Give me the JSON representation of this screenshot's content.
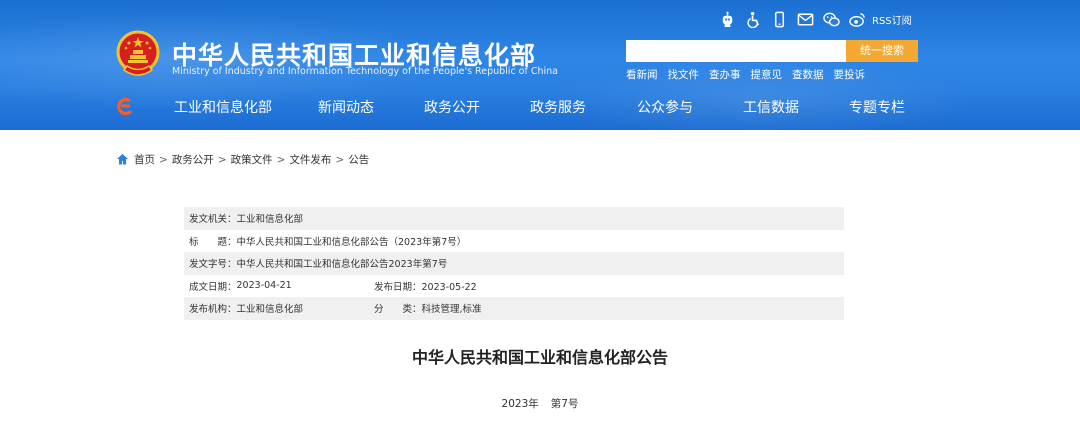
{
  "header": {
    "site_title": "中华人民共和国工业和信息化部",
    "site_subtitle": "Ministry of Industry and Information Technology of the People's Republic of China",
    "top_icons": [
      "robot-icon",
      "accessibility-icon",
      "mobile-icon",
      "mail-icon",
      "wechat-icon",
      "weibo-icon"
    ],
    "rss_label": "RSS订阅",
    "search_placeholder": "",
    "search_button": "统一搜索",
    "quick_links": [
      "看新闻",
      "找文件",
      "查办事",
      "提意见",
      "查数据",
      "要投诉"
    ]
  },
  "nav": {
    "items": [
      "工业和信息化部",
      "新闻动态",
      "政务公开",
      "政务服务",
      "公众参与",
      "工信数据",
      "专题专栏"
    ]
  },
  "breadcrumb": {
    "items": [
      "首页",
      "政务公开",
      "政策文件",
      "文件发布",
      "公告"
    ],
    "separator": ">"
  },
  "info": {
    "issuer_label": "发文机关：",
    "issuer": "工业和信息化部",
    "title_label": "标　　题：",
    "title": "中华人民共和国工业和信息化部公告（2023年第7号）",
    "doc_no_label": "发文字号：",
    "doc_no": "中华人民共和国工业和信息化部公告2023年第7号",
    "written_date_label": "成文日期：",
    "written_date": "2023-04-21",
    "publish_date_label": "发布日期：",
    "publish_date": "2023-05-22",
    "publisher_label": "发布机构：",
    "publisher": "工业和信息化部",
    "category_label": "分　　类：",
    "category": "科技管理,标准"
  },
  "document": {
    "title": "中华人民共和国工业和信息化部公告",
    "year": "2023年",
    "number": "第7号"
  },
  "colors": {
    "header_blue": "#2a7fe0",
    "search_button": "#f3a832",
    "emblem_red": "#d71f1f",
    "emblem_gold": "#f4c430"
  }
}
